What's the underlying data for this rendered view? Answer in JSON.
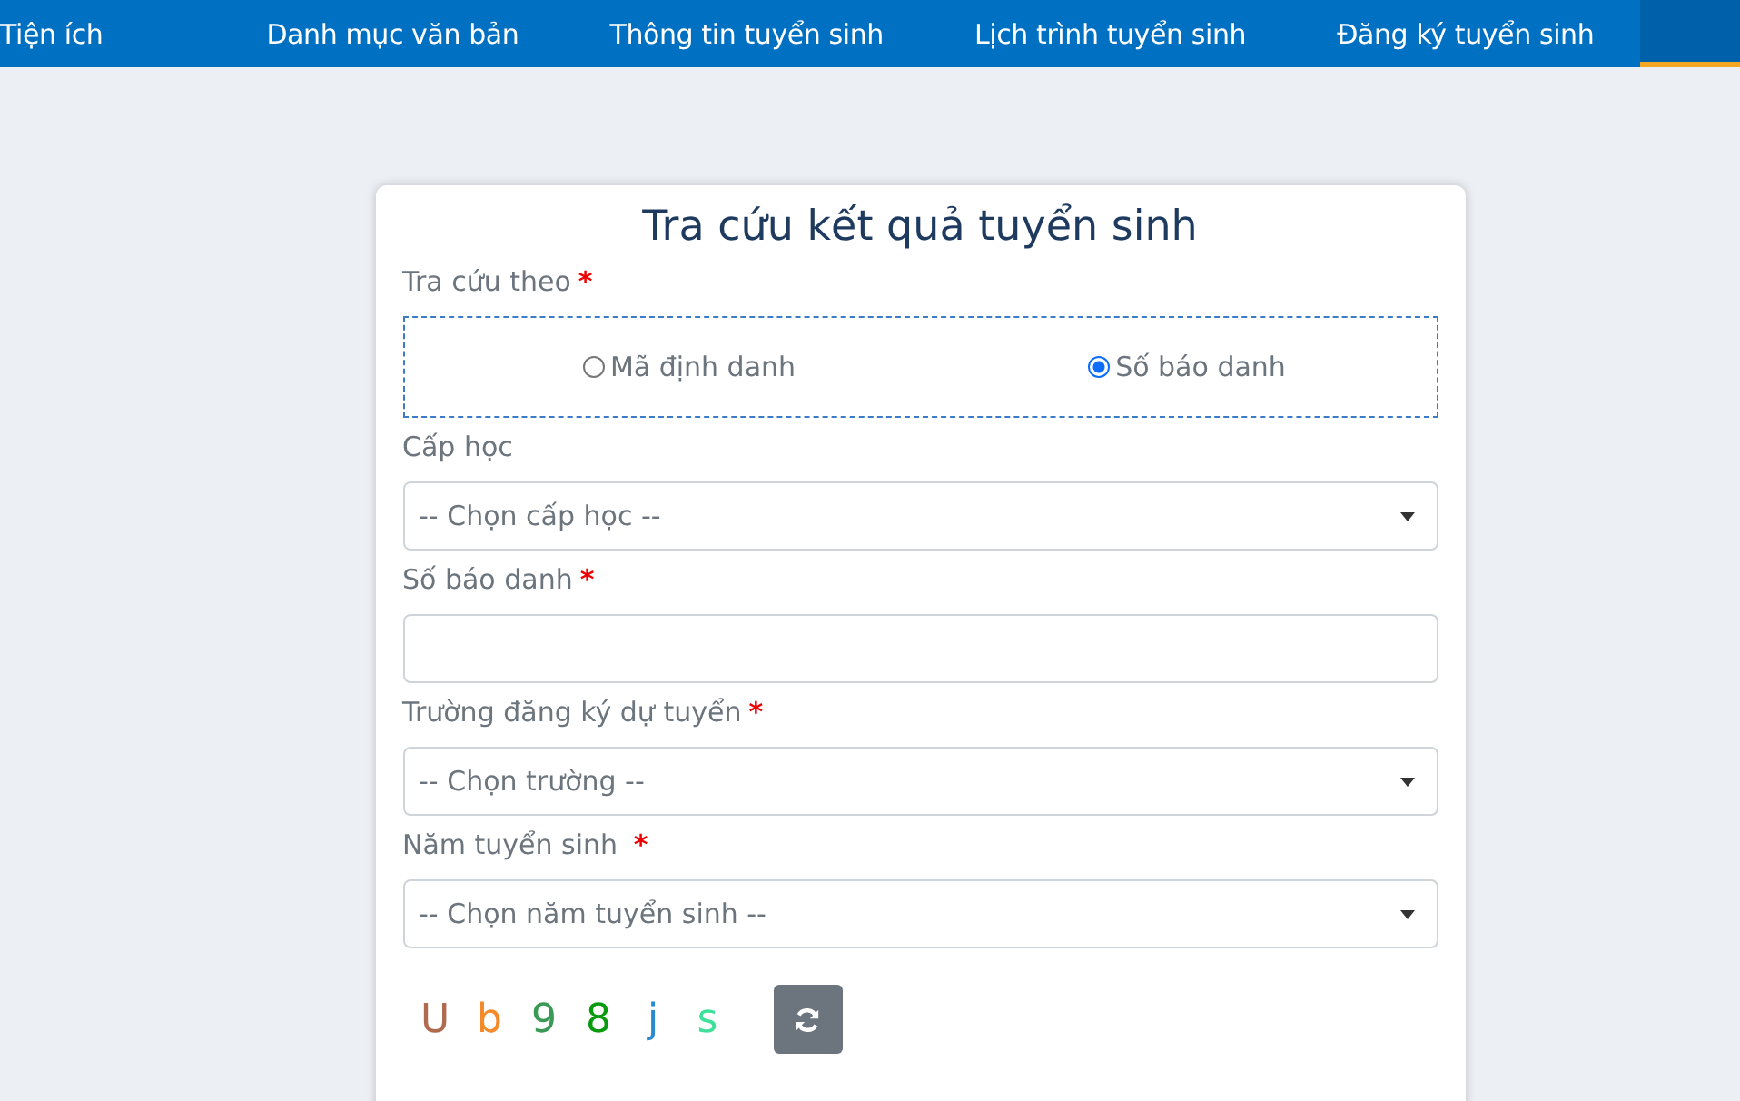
{
  "nav": {
    "items": [
      {
        "label": "Tiện ích"
      },
      {
        "label": "Danh mục văn bản"
      },
      {
        "label": "Thông tin tuyển sinh"
      },
      {
        "label": "Lịch trình tuyển sinh"
      },
      {
        "label": "Đăng ký tuyển sinh"
      }
    ]
  },
  "form": {
    "title": "Tra cứu kết quả tuyển sinh",
    "lookup": {
      "label": "Tra cứu theo",
      "required_mark": "*",
      "options": [
        {
          "label": "Mã định danh",
          "selected": false
        },
        {
          "label": "Số báo danh",
          "selected": true
        }
      ]
    },
    "fields": [
      {
        "kind": "select",
        "label": "Cấp học",
        "placeholder": "-- Chọn cấp học --"
      },
      {
        "kind": "text",
        "label": "Số báo danh",
        "required_mark": "*"
      },
      {
        "kind": "select",
        "label": "Trường đăng ký dự tuyển",
        "required_mark": "*",
        "placeholder": "-- Chọn trường --"
      },
      {
        "kind": "select",
        "label": "Năm tuyển sinh ",
        "required_mark": "*",
        "placeholder": "-- Chọn năm tuyển sinh --"
      }
    ],
    "captcha": [
      {
        "char": "U",
        "color": "#b06a4e"
      },
      {
        "char": "b",
        "color": "#f58a2a"
      },
      {
        "char": "9",
        "color": "#3a9a55"
      },
      {
        "char": "8",
        "color": "#0a9a10"
      },
      {
        "char": "j",
        "color": "#2a8ad0"
      },
      {
        "char": "s",
        "color": "#3ee09a"
      }
    ]
  }
}
